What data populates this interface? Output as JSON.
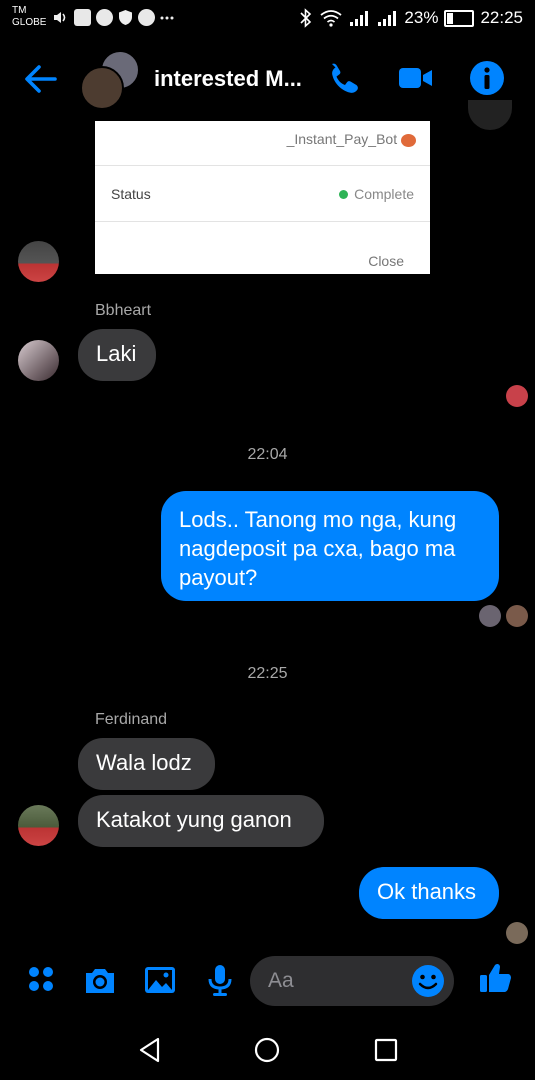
{
  "status_bar": {
    "carrier_line1": "TM",
    "carrier_line2": "GLOBE",
    "battery": "23%",
    "time": "22:25"
  },
  "header": {
    "title": "interested M...",
    "accent": "#0084ff"
  },
  "shared_image": {
    "bot_name": "_Instant_Pay_Bot",
    "status_label": "Status",
    "status_value": "Complete",
    "close_label": "Close"
  },
  "messages": {
    "bbheart_name": "Bbheart",
    "bbheart_msg": "Laki",
    "time1": "22:04",
    "outgoing1": "Lods.. Tanong mo nga, kung nagdeposit pa cxa, bago ma payout?",
    "time2": "22:25",
    "ferdinand_name": "Ferdinand",
    "ferdinand_msg1": "Wala lodz",
    "ferdinand_msg2": "Katakot yung ganon",
    "outgoing2": "Ok thanks"
  },
  "composer": {
    "placeholder": "Aa"
  }
}
